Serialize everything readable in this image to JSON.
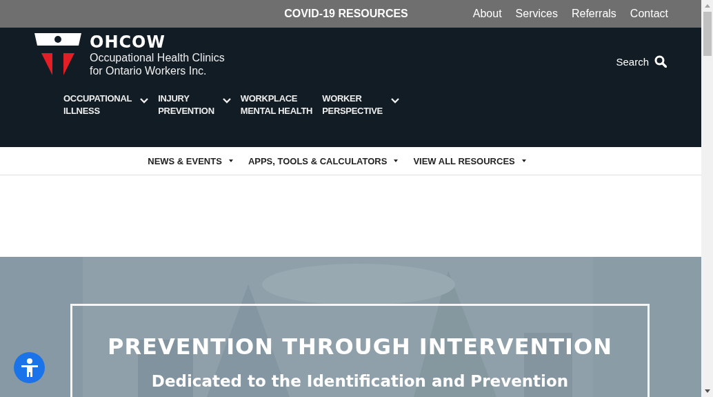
{
  "top_bar": {
    "highlight": "COVID-19 RESOURCES",
    "links": [
      "About",
      "Services",
      "Referrals",
      "Contact"
    ]
  },
  "logo": {
    "name": "OHCOW",
    "tagline_1": "Occupational Health Clinics",
    "tagline_2": "for Ontario Workers Inc."
  },
  "search": {
    "label": "Search"
  },
  "main_nav": [
    {
      "line_1": "OCCUPATIONAL",
      "line_2": "ILLNESS",
      "has_dropdown": true
    },
    {
      "line_1": "INJURY",
      "line_2": "PREVENTION",
      "has_dropdown": true
    },
    {
      "line_1": "WORKPLACE",
      "line_2": "MENTAL HEALTH",
      "has_dropdown": false
    },
    {
      "line_1": "WORKER",
      "line_2": "PERSPECTIVE",
      "has_dropdown": true
    }
  ],
  "sub_nav": [
    {
      "label": "NEWS & EVENTS",
      "has_dropdown": true
    },
    {
      "label": "APPS, TOOLS & CALCULATORS",
      "has_dropdown": true
    },
    {
      "label": "VIEW ALL RESOURCES",
      "has_dropdown": true
    }
  ],
  "hero": {
    "kind": "picture",
    "heading": "PREVENTION THROUGH INTERVENTION",
    "subheading": "Dedicated to the Identification and Prevention"
  }
}
